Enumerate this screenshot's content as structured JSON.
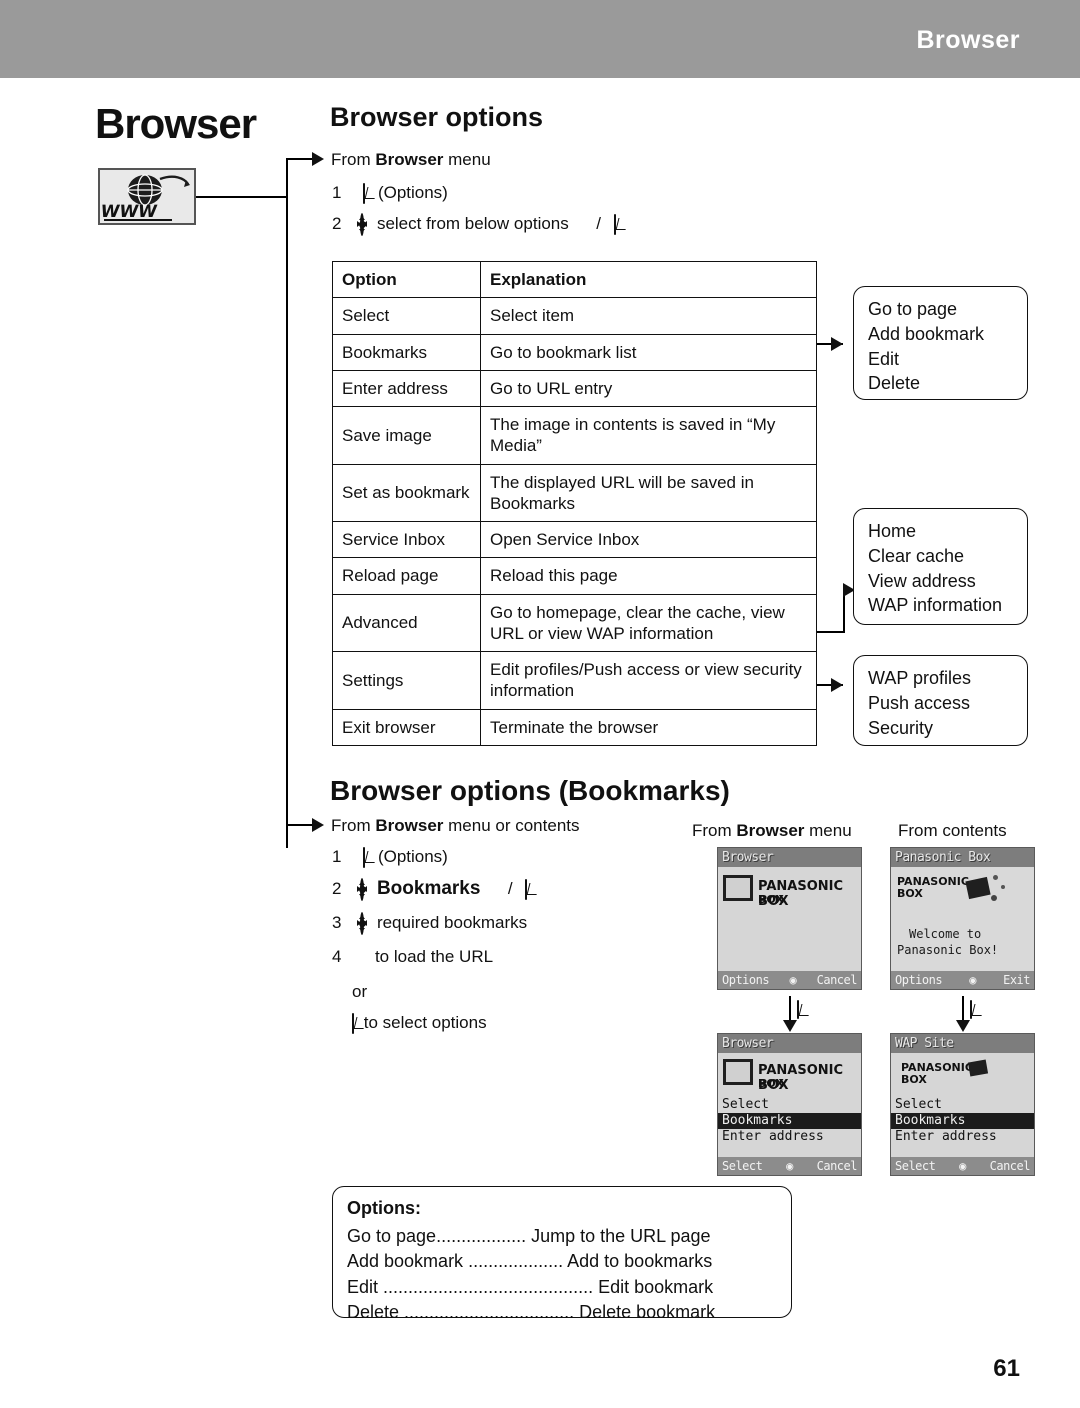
{
  "header": {
    "title": "Browser"
  },
  "page": {
    "title": "Browser",
    "number": "61",
    "icon": "www-globe-icon"
  },
  "section1": {
    "title": "Browser options",
    "intro_prefix": "From ",
    "intro_bold": "Browser",
    "intro_suffix": " menu",
    "step1_num": "1",
    "step1_label": "(Options)",
    "step2_num": "2",
    "step2_label": "select from below options",
    "step2_sep": "/",
    "table": {
      "headers": [
        "Option",
        "Explanation"
      ],
      "rows": [
        [
          "Select",
          "Select item"
        ],
        [
          "Bookmarks",
          "Go to bookmark list"
        ],
        [
          "Enter address",
          "Go to URL entry"
        ],
        [
          "Save image",
          "The image in contents is saved in “My Media”"
        ],
        [
          "Set as bookmark",
          "The displayed URL will be saved in Bookmarks"
        ],
        [
          "Service Inbox",
          "Open Service Inbox"
        ],
        [
          "Reload page",
          "Reload this page"
        ],
        [
          "Advanced",
          "Go to homepage, clear the cache, view URL or view WAP information"
        ],
        [
          "Settings",
          "Edit profiles/Push access or view security information"
        ],
        [
          "Exit browser",
          "Terminate the browser"
        ]
      ]
    },
    "callouts": [
      {
        "name": "bookmarks-callout",
        "items": [
          "Go to page",
          "Add bookmark",
          "Edit",
          "Delete"
        ]
      },
      {
        "name": "advanced-callout",
        "items": [
          "Home",
          "Clear cache",
          "View address",
          "WAP information"
        ]
      },
      {
        "name": "settings-callout",
        "items": [
          "WAP profiles",
          "Push access",
          "Security"
        ]
      }
    ]
  },
  "section2": {
    "title": "Browser options (Bookmarks)",
    "intro_prefix": "From ",
    "intro_bold": "Browser",
    "intro_suffix": " menu or contents",
    "steps": [
      {
        "num": "1",
        "text": "(Options)"
      },
      {
        "num": "2",
        "text": "Bookmarks"
      },
      {
        "num": "3",
        "text": "required bookmarks"
      },
      {
        "num": "4",
        "text": "to load the URL"
      }
    ],
    "or_text": "or",
    "select_options_text": "to select options",
    "col_left_label_prefix": "From ",
    "col_left_label_bold": "Browser",
    "col_left_label_suffix": " menu",
    "col_right_label": "From contents",
    "screens": [
      {
        "name": "browser-menu-screen",
        "title": "Browser",
        "content_line1": "PANASONIC BOX",
        "content_line2": "BOX",
        "soft_left": "Options",
        "soft_right": "Cancel"
      },
      {
        "name": "panasonic-box-screen",
        "title": "Panasonic Box",
        "content_line1": "PANASONIC",
        "content_line2": "BOX",
        "welcome_line1": "Welcome to",
        "welcome_line2": "Panasonic Box!",
        "soft_left": "Options",
        "soft_right": "Exit"
      },
      {
        "name": "browser-options-menu-screen",
        "title": "Browser",
        "content_line1": "PANASONIC BOX",
        "content_line2": "BOX",
        "menu": [
          "Select",
          "Bookmarks",
          "Enter address"
        ],
        "menu_selected_index": 1,
        "soft_left": "Select",
        "soft_right": "Cancel"
      },
      {
        "name": "wap-site-options-screen",
        "title": "WAP Site",
        "content_line1": "PANASONIC",
        "content_line2": "BOX",
        "menu": [
          "Select",
          "Bookmarks",
          "Enter address"
        ],
        "menu_selected_index": 1,
        "soft_left": "Select",
        "soft_right": "Cancel"
      }
    ],
    "options_box": {
      "title": "Options:",
      "rows": [
        {
          "label": "Go to page",
          "dots": "..................",
          "value": "Jump to the URL page"
        },
        {
          "label": "Add bookmark",
          "dots": "...................",
          "value": "Add to bookmarks"
        },
        {
          "label": "Edit",
          "dots": "..........................................",
          "value": "Edit bookmark"
        },
        {
          "label": "Delete",
          "dots": "..................................",
          "value": "Delete bookmark"
        }
      ]
    }
  }
}
